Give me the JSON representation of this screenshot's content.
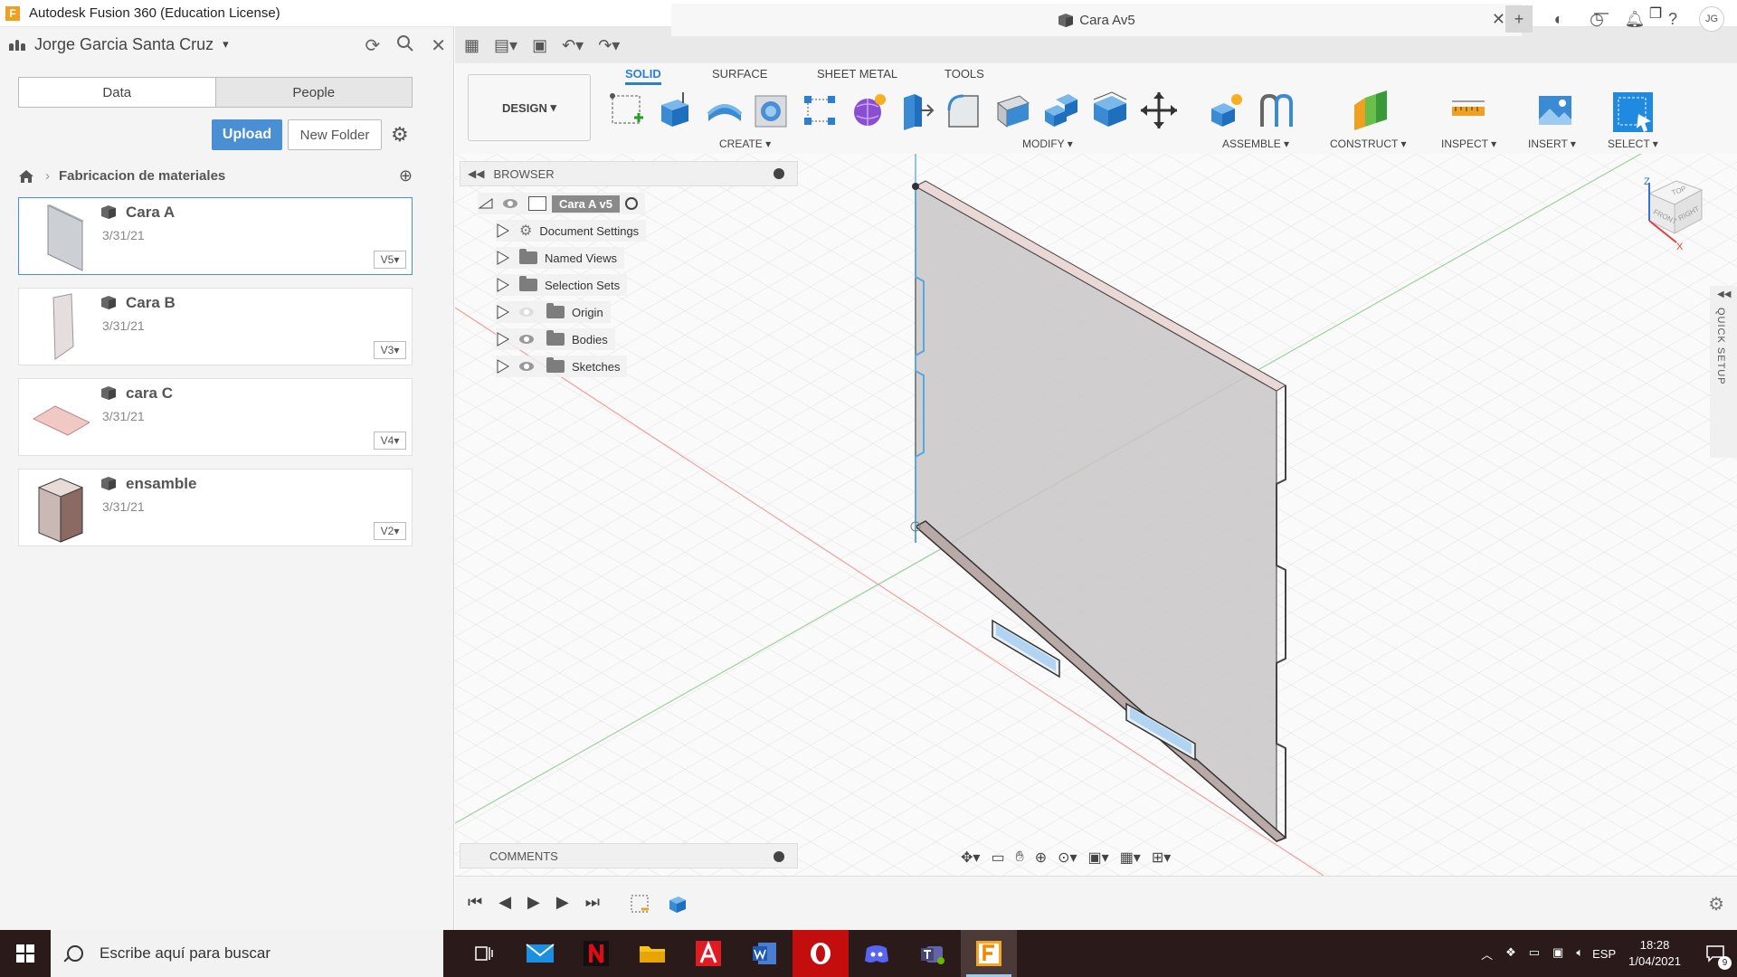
{
  "window": {
    "title": "Autodesk Fusion 360 (Education License)",
    "minimize": "—",
    "restore": "❐",
    "close": "✕"
  },
  "data_panel": {
    "user": "Jorge Garcia Santa Cruz",
    "tabs": [
      "Data",
      "People"
    ],
    "upload_label": "Upload",
    "new_folder_label": "New Folder",
    "breadcrumb": "Fabricacion de materiales",
    "items": [
      {
        "name": "Cara A",
        "date": "3/31/21",
        "version": "V5"
      },
      {
        "name": "Cara B",
        "date": "3/31/21",
        "version": "V3"
      },
      {
        "name": "cara C",
        "date": "3/31/21",
        "version": "V4"
      },
      {
        "name": "ensamble",
        "date": "3/31/21",
        "version": "V2"
      }
    ]
  },
  "document_tab": {
    "title": "Cara Av5",
    "avatar": "JG"
  },
  "toolbar": {
    "workspace": "DESIGN",
    "tabs": [
      "SOLID",
      "SURFACE",
      "SHEET METAL",
      "TOOLS"
    ],
    "active_tab": "SOLID",
    "groups": [
      "CREATE",
      "MODIFY",
      "ASSEMBLE",
      "CONSTRUCT",
      "INSPECT",
      "INSERT",
      "SELECT"
    ]
  },
  "browser": {
    "label": "BROWSER",
    "root": "Cara A v5",
    "items": [
      "Document Settings",
      "Named Views",
      "Selection Sets",
      "Origin",
      "Bodies",
      "Sketches"
    ]
  },
  "comments": {
    "label": "COMMENTS"
  },
  "viewcube": {
    "top": "TOP",
    "front": "FRONT",
    "right": "RIGHT",
    "z": "Z",
    "x": "X"
  },
  "quick_setup": "QUICK SETUP",
  "taskbar": {
    "search_placeholder": "Escribe aquí para buscar",
    "language": "ESP",
    "time": "18:28",
    "date": "1/04/2021",
    "notifications": "9"
  },
  "colors": {
    "accent": "#2a7fd4",
    "upload": "#4a8ed4",
    "taskbar": "#2a1a1a"
  }
}
